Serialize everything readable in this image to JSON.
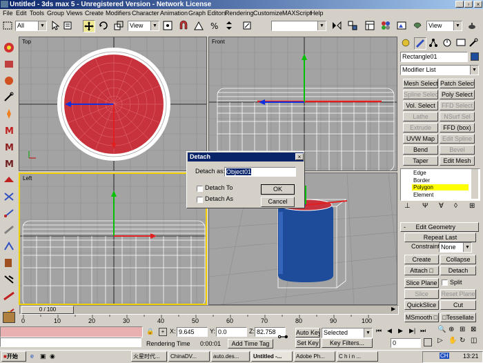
{
  "app": {
    "title": "Untitled - 3ds max 5 - Unregistered Version - Network License"
  },
  "menu": [
    "File",
    "Edit",
    "Tools",
    "Group",
    "Views",
    "Create",
    "Modifiers",
    "Character",
    "Animation",
    "Graph Editors",
    "Rendering",
    "Customize",
    "MAXScript",
    "Help"
  ],
  "toolbar": {
    "selection_filter": "All",
    "reference_coord": "View",
    "named_selection": "",
    "view_right": "View"
  },
  "viewports": {
    "top": "Top",
    "front": "Front",
    "left": "Left",
    "perspective": ""
  },
  "command_panel": {
    "object_name": "Rectangle01",
    "modifier_list": "Modifier List",
    "modifier_buttons": [
      {
        "label": "Mesh Select",
        "enabled": true
      },
      {
        "label": "Patch Select",
        "enabled": true
      },
      {
        "label": "Spline Select",
        "enabled": false
      },
      {
        "label": "Poly Select",
        "enabled": true
      },
      {
        "label": "Vol. Select",
        "enabled": true
      },
      {
        "label": "FFD Select",
        "enabled": false
      },
      {
        "label": "Lathe",
        "enabled": false
      },
      {
        "label": "NSurf Sel",
        "enabled": false
      },
      {
        "label": "Extrude",
        "enabled": false
      },
      {
        "label": "FFD (box)",
        "enabled": true
      },
      {
        "label": "UVW Map",
        "enabled": true
      },
      {
        "label": "Edit Spline",
        "enabled": false
      },
      {
        "label": "Bend",
        "enabled": true
      },
      {
        "label": "Bevel",
        "enabled": false
      },
      {
        "label": "Taper",
        "enabled": true
      },
      {
        "label": "Edit Mesh",
        "enabled": true
      }
    ],
    "stack": [
      "Edge",
      "Border",
      "Polygon",
      "Element"
    ],
    "stack_selected": "Polygon",
    "rollout_title": "Edit Geometry",
    "repeat_last": "Repeat Last",
    "constraints_label": "Constraints:",
    "constraints_value": "None",
    "create": "Create",
    "collapse": "Collapse",
    "attach": "Attach",
    "detach": "Detach",
    "slice_plane": "Slice Plane",
    "split": "Split",
    "slice": "Slice",
    "reset_plane": "Reset Plane",
    "quickslice": "QuickSlice",
    "cut": "Cut",
    "msmooth": "MSmooth",
    "tessellate": "Tessellate"
  },
  "dialog": {
    "title": "Detach",
    "detach_as_label": "Detach as:",
    "detach_as_value": "Object01",
    "detach_to": "Detach To",
    "detach_as_clone": "Detach As",
    "ok": "OK",
    "cancel": "Cancel"
  },
  "timeline": {
    "slider": "0 / 100",
    "ticks": [
      "0",
      "10",
      "20",
      "30",
      "40",
      "50",
      "60",
      "70",
      "80",
      "90",
      "100"
    ]
  },
  "status": {
    "prompt_field": "",
    "x": "9.645",
    "y": "0.0",
    "z": "82.758",
    "rendering_label": "Rendering Time",
    "rendering_time": "0:00:01",
    "add_time_tag": "Add Time Tag",
    "auto_key": "Auto Key",
    "set_key": "Set Key",
    "key_filter_value": "Selected",
    "key_filters": "Key Filters...",
    "frame": "0"
  },
  "taskbar": {
    "start": "开始",
    "items": [
      "火星时代...",
      "ChinaDV...",
      "auto.des...",
      "Untitled -...",
      "Adobe Ph...",
      "C h i n ..."
    ],
    "clock": "13:21",
    "tray_label": "CH"
  },
  "colors": {
    "title_bar": "#0a246a",
    "viewport_bg": "#a3a3a3",
    "selected_wire": "#ffffff",
    "object_red": "#c8323c",
    "object_blue": "#1e4c9a",
    "active_viewport_border": "#f0d000",
    "stack_highlight": "#ffff00"
  }
}
